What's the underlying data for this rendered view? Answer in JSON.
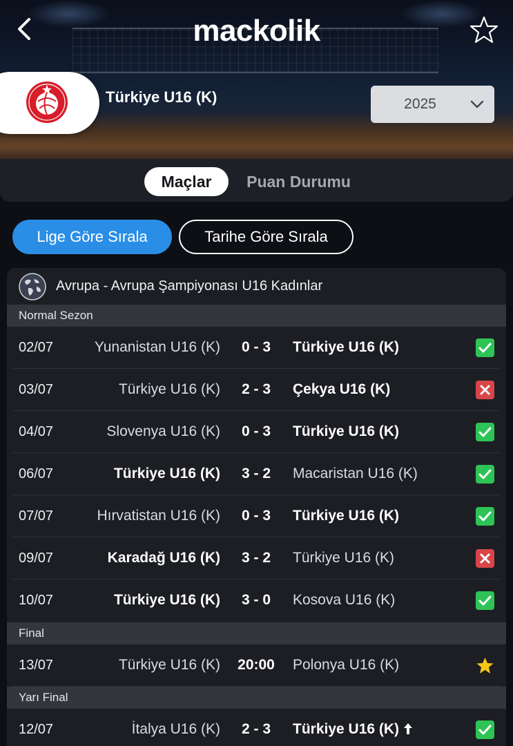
{
  "header": {
    "brand": "mackolik",
    "team_name": "Türkiye U16 (K)",
    "season": "2025"
  },
  "tabs": [
    {
      "label": "Maçlar",
      "active": true
    },
    {
      "label": "Puan Durumu",
      "active": false
    }
  ],
  "sort_buttons": [
    {
      "label": "Lige Göre Sırala",
      "active": true
    },
    {
      "label": "Tarihe Göre Sırala",
      "active": false
    }
  ],
  "league": {
    "name": "Avrupa - Avrupa Şampiyonası U16 Kadınlar"
  },
  "sections": [
    {
      "title": "Normal Sezon",
      "matches": [
        {
          "date": "02/07",
          "home": "Yunanistan U16 (K)",
          "score": "0 - 3",
          "away": "Türkiye U16 (K)",
          "winner": "away",
          "result": "win"
        },
        {
          "date": "03/07",
          "home": "Türkiye U16 (K)",
          "score": "2 - 3",
          "away": "Çekya U16 (K)",
          "winner": "away",
          "result": "loss"
        },
        {
          "date": "04/07",
          "home": "Slovenya U16 (K)",
          "score": "0 - 3",
          "away": "Türkiye U16 (K)",
          "winner": "away",
          "result": "win"
        },
        {
          "date": "06/07",
          "home": "Türkiye U16 (K)",
          "score": "3 - 2",
          "away": "Macaristan U16 (K)",
          "winner": "home",
          "result": "win"
        },
        {
          "date": "07/07",
          "home": "Hırvatistan U16 (K)",
          "score": "0 - 3",
          "away": "Türkiye U16 (K)",
          "winner": "away",
          "result": "win"
        },
        {
          "date": "09/07",
          "home": "Karadağ U16 (K)",
          "score": "3 - 2",
          "away": "Türkiye U16 (K)",
          "winner": "home",
          "result": "loss"
        },
        {
          "date": "10/07",
          "home": "Türkiye U16 (K)",
          "score": "3 - 0",
          "away": "Kosova U16 (K)",
          "winner": "home",
          "result": "win"
        }
      ]
    },
    {
      "title": "Final",
      "matches": [
        {
          "date": "13/07",
          "home": "Türkiye U16 (K)",
          "score": "20:00",
          "away": "Polonya U16 (K)",
          "winner": "none",
          "result": "scheduled"
        }
      ]
    },
    {
      "title": "Yarı Final",
      "matches": [
        {
          "date": "12/07",
          "home": "İtalya U16 (K)",
          "score": "2 - 3",
          "away": "Türkiye U16 (K)",
          "winner": "away",
          "result": "win",
          "qualified_icon": "arrow-up-icon"
        }
      ]
    }
  ],
  "colors": {
    "win": "#2ec356",
    "loss": "#d8464a",
    "scheduled": "#f5c518",
    "accent": "#2b8ee6"
  }
}
